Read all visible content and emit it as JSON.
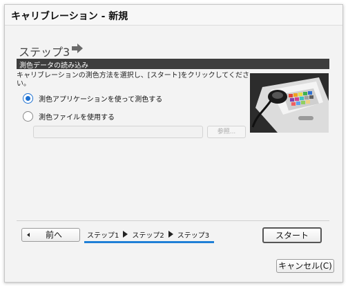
{
  "window": {
    "title": "キャリブレーション - 新規"
  },
  "step": {
    "title": "ステップ3"
  },
  "section": {
    "label": "測色データの読み込み"
  },
  "instruction": "キャリブレーションの測色方法を選択し、[スタート]をクリックしてください。",
  "options": [
    {
      "label": "測色アプリケーションを使って測色する",
      "selected": true
    },
    {
      "label": "測色ファイルを使用する",
      "selected": false
    }
  ],
  "file": {
    "value": "",
    "browse_label": "参照..."
  },
  "nav": {
    "prev_label": "前へ",
    "steps": [
      "ステップ1",
      "ステップ2",
      "ステップ3"
    ],
    "progress": 1.0,
    "start_label": "スタート",
    "cancel_label": "キャンセル(C)"
  },
  "colors": {
    "accent": "#1a6fd1",
    "section_bar": "#3d3d3d"
  }
}
